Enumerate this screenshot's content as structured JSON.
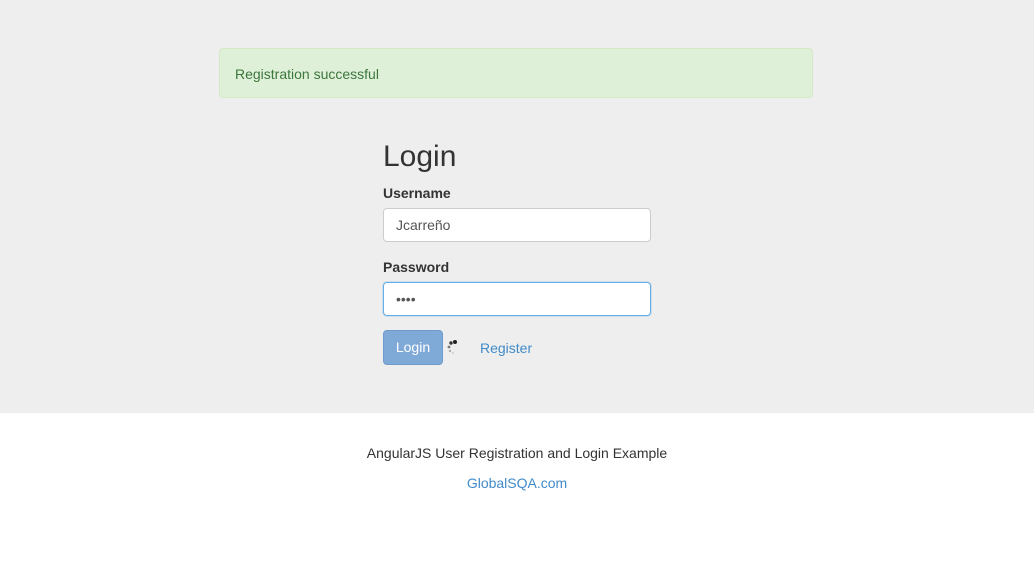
{
  "alert": {
    "message": "Registration successful"
  },
  "login": {
    "title": "Login",
    "username_label": "Username",
    "username_value": "Jcarreño",
    "password_label": "Password",
    "password_value": "••••",
    "login_button": "Login",
    "register_link": "Register"
  },
  "footer": {
    "text": "AngularJS User Registration and Login Example",
    "link": "GlobalSQA.com"
  },
  "colors": {
    "jumbotron_bg": "#eeeeee",
    "alert_bg": "#dff0d8",
    "alert_text": "#3c763d",
    "link": "#428bca",
    "button_bg": "#7fa9d7"
  }
}
